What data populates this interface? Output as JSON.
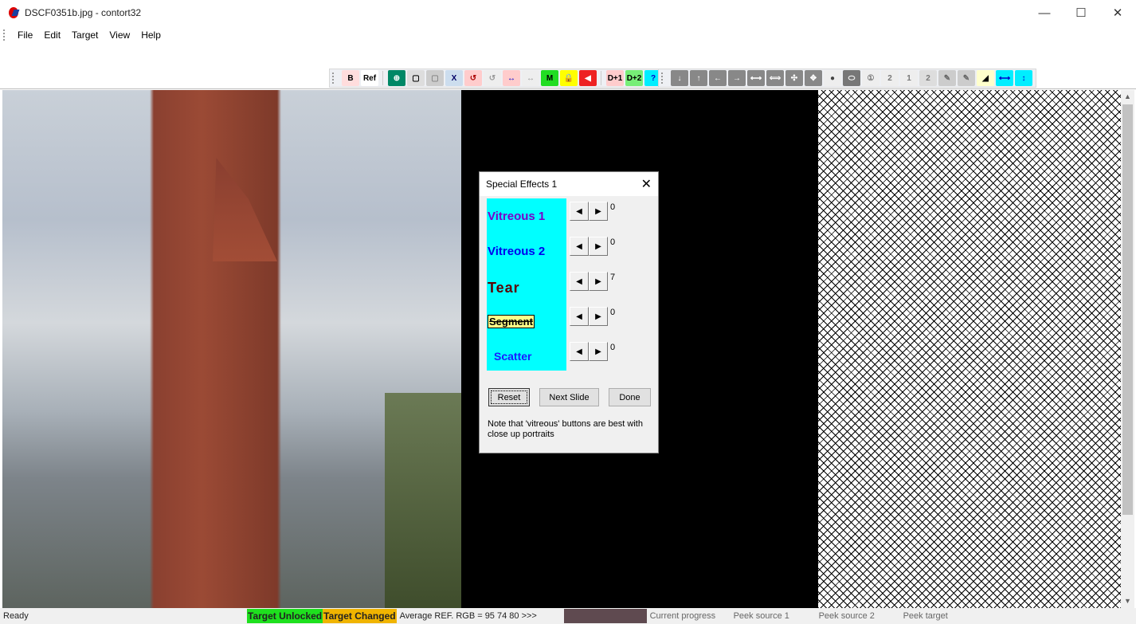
{
  "window": {
    "title": "DSCF0351b.jpg - contort32",
    "minimize": "—",
    "maximize": "☐",
    "close": "✕"
  },
  "menu": [
    "File",
    "Edit",
    "Target",
    "View",
    "Help"
  ],
  "toolbar1": [
    {
      "name": "reference-b-icon",
      "glyph": "B",
      "bg": "#fdd",
      "fg": "#000"
    },
    {
      "name": "ref-icon",
      "glyph": "Ref",
      "bg": "#fff",
      "fg": "#000"
    },
    {
      "name": "zoom-icon",
      "glyph": "⊕",
      "bg": "#086",
      "fg": "#fff"
    },
    {
      "name": "window-1-icon",
      "glyph": "▢",
      "bg": "#ddd",
      "fg": "#000"
    },
    {
      "name": "window-2-icon",
      "glyph": "▢",
      "bg": "#ccc",
      "fg": "#888"
    },
    {
      "name": "window-x-icon",
      "glyph": "X",
      "bg": "#cde",
      "fg": "#006"
    },
    {
      "name": "rotate-1-icon",
      "glyph": "↺",
      "bg": "#fcc",
      "fg": "#a00"
    },
    {
      "name": "rotate-2-icon",
      "glyph": "↺",
      "bg": "#eee",
      "fg": "#999"
    },
    {
      "name": "swap-1-icon",
      "glyph": "↔",
      "bg": "#fcc",
      "fg": "#00c"
    },
    {
      "name": "swap-2-icon",
      "glyph": "↔",
      "bg": "#eee",
      "fg": "#999"
    },
    {
      "name": "m-icon",
      "glyph": "M",
      "bg": "#2d2",
      "fg": "#000"
    },
    {
      "name": "lock-icon",
      "glyph": "🔒",
      "bg": "#ff0",
      "fg": "#000"
    },
    {
      "name": "back-icon",
      "glyph": "◀",
      "bg": "#e22",
      "fg": "#fff"
    },
    {
      "name": "d-plus-1-icon",
      "glyph": "D+1",
      "bg": "#fcc",
      "fg": "#000"
    },
    {
      "name": "d-plus-2-icon",
      "glyph": "D+2",
      "bg": "#7e7",
      "fg": "#000"
    },
    {
      "name": "help-icon",
      "glyph": "?",
      "bg": "#0ef",
      "fg": "#00c"
    }
  ],
  "toolbar2": [
    {
      "name": "arrow-down-icon",
      "glyph": "↓",
      "bg": "#888",
      "fg": "#fff"
    },
    {
      "name": "arrow-up-icon",
      "glyph": "↑",
      "bg": "#888",
      "fg": "#fff"
    },
    {
      "name": "arrow-left-icon",
      "glyph": "←",
      "bg": "#888",
      "fg": "#fff"
    },
    {
      "name": "arrow-right-icon",
      "glyph": "→",
      "bg": "#888",
      "fg": "#fff"
    },
    {
      "name": "expand-h-icon",
      "glyph": "⟷",
      "bg": "#888",
      "fg": "#fff"
    },
    {
      "name": "contract-h-icon",
      "glyph": "⟺",
      "bg": "#888",
      "fg": "#fff"
    },
    {
      "name": "shrink-icon",
      "glyph": "✣",
      "bg": "#888",
      "fg": "#fff"
    },
    {
      "name": "grow-icon",
      "glyph": "✥",
      "bg": "#888",
      "fg": "#fff"
    },
    {
      "name": "dot-icon",
      "glyph": "●",
      "bg": "#eee",
      "fg": "#444"
    },
    {
      "name": "ellipse-icon",
      "glyph": "⬭",
      "bg": "#777",
      "fg": "#fff"
    },
    {
      "name": "circle-1-icon",
      "glyph": "①",
      "bg": "#eee",
      "fg": "#777"
    },
    {
      "name": "circle-2-icon",
      "glyph": "2",
      "bg": "#eee",
      "fg": "#777"
    },
    {
      "name": "square-1-icon",
      "glyph": "1",
      "bg": "#eee",
      "fg": "#777"
    },
    {
      "name": "square-2-icon",
      "glyph": "2",
      "bg": "#ddd",
      "fg": "#777"
    },
    {
      "name": "brush-1-icon",
      "glyph": "✎",
      "bg": "#ccc",
      "fg": "#666"
    },
    {
      "name": "brush-2-icon",
      "glyph": "✎",
      "bg": "#ccc",
      "fg": "#666"
    },
    {
      "name": "gradient-icon",
      "glyph": "◢",
      "bg": "#ffc",
      "fg": "#000"
    },
    {
      "name": "stretch-h-icon",
      "glyph": "⟷",
      "bg": "#0ef",
      "fg": "#00c"
    },
    {
      "name": "stretch-v-icon",
      "glyph": "↕",
      "bg": "#0ef",
      "fg": "#00c"
    }
  ],
  "dialog": {
    "title": "Special Effects 1",
    "close": "✕",
    "effects": [
      {
        "label": "Vitreous 1",
        "value": "0",
        "color": "#7a00c8"
      },
      {
        "label": "Vitreous 2",
        "value": "0",
        "color": "#0000ee"
      },
      {
        "label": "Tear",
        "value": "7",
        "color": "#5a0000"
      },
      {
        "label": "Segment",
        "value": "0",
        "color": "#000"
      },
      {
        "label": "Scatter",
        "value": "0",
        "color": "#1a1aff"
      }
    ],
    "left_arrow": "◀",
    "right_arrow": "▶",
    "reset": "Reset",
    "next": "Next Slide",
    "done": "Done",
    "note": "Note that 'vitreous' buttons are best with close up portraits"
  },
  "status": {
    "ready": "Ready",
    "unlocked": "Target Unlocked",
    "changed": "Target Changed",
    "avg": "Average REF. RGB = 95 74 80  >>>",
    "swatch_color": "#5f4a50",
    "progress": "Current progress",
    "peek1": "Peek source 1",
    "peek2": "Peek source 2",
    "peekt": "Peek target"
  }
}
